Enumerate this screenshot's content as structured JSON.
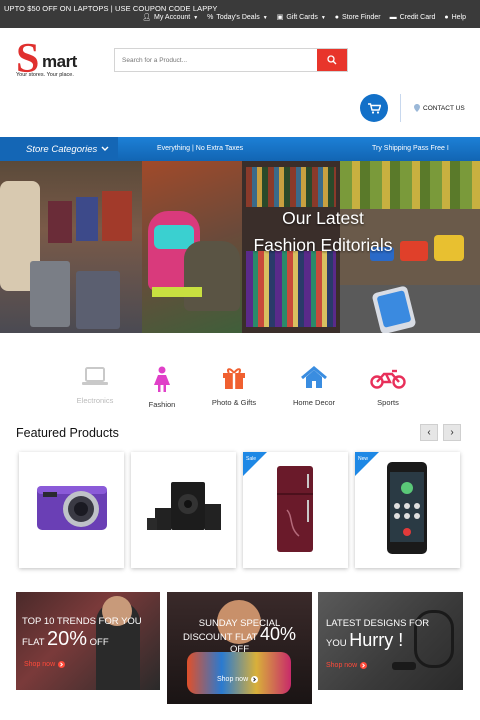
{
  "topbar": {
    "promo": "UPTO $50 OFF ON LAPTOPS | USE COUPON CODE LAPPY",
    "links": [
      {
        "label": "My Account",
        "icon": "user-icon",
        "caret": true
      },
      {
        "label": "Today's Deals",
        "icon": "percent-icon",
        "caret": true
      },
      {
        "label": "Gift Cards",
        "icon": "gift-icon",
        "caret": true
      },
      {
        "label": "Store Finder",
        "icon": "map-marker-icon",
        "caret": false
      },
      {
        "label": "Credit Card",
        "icon": "credit-card-icon",
        "caret": false
      },
      {
        "label": "Help",
        "icon": "help-icon",
        "caret": false
      }
    ]
  },
  "logo": {
    "initial": "S",
    "rest": "mart",
    "tagline": "Your stores. Your place."
  },
  "search": {
    "placeholder": "Search for a Product..."
  },
  "header": {
    "contact": "CONTACT US"
  },
  "nav": {
    "categories_label": "Store Categories",
    "ticker_1": "Everything | No Extra Taxes",
    "ticker_2": "Try Shipping Pass Free I"
  },
  "hero": {
    "line1": "Our Latest",
    "line2": "Fashion Editorials"
  },
  "categories": [
    {
      "label": "Electronics",
      "icon": "laptop-icon",
      "color": "#c9c9c9"
    },
    {
      "label": "Fashion",
      "icon": "female-icon",
      "color": "#e040c8"
    },
    {
      "label": "Photo & Gifts",
      "icon": "gift-icon",
      "color": "#f06030"
    },
    {
      "label": "Home Decor",
      "icon": "home-icon",
      "color": "#3a8de0"
    },
    {
      "label": "Sports",
      "icon": "motorcycle-icon",
      "color": "#e8305a"
    }
  ],
  "featured": {
    "title": "Featured Products",
    "products": [
      {
        "name": "camera",
        "badge": ""
      },
      {
        "name": "speaker-system",
        "badge": ""
      },
      {
        "name": "refrigerator",
        "badge": "Sale"
      },
      {
        "name": "smartphone",
        "badge": "New"
      }
    ]
  },
  "promos": [
    {
      "l1a": "TOP 10 TRENDS FOR YOU",
      "l2a": "FLAT ",
      "big": "20%",
      "l2b": " OFF",
      "cta": "Shop now"
    },
    {
      "l1a": "SUNDAY SPECIAL",
      "l2a": "DISCOUNT FLAT ",
      "big": "40%",
      "l2b": "OFF",
      "cta": "Shop now"
    },
    {
      "l1a": "LATEST DESIGNS FOR",
      "l2a": "YOU ",
      "big": "Hurry !",
      "l2b": "",
      "cta": "Shop now"
    }
  ],
  "colors": {
    "accent": "#1270c8",
    "red": "#e8352b",
    "topbar": "#3a3a3a"
  }
}
